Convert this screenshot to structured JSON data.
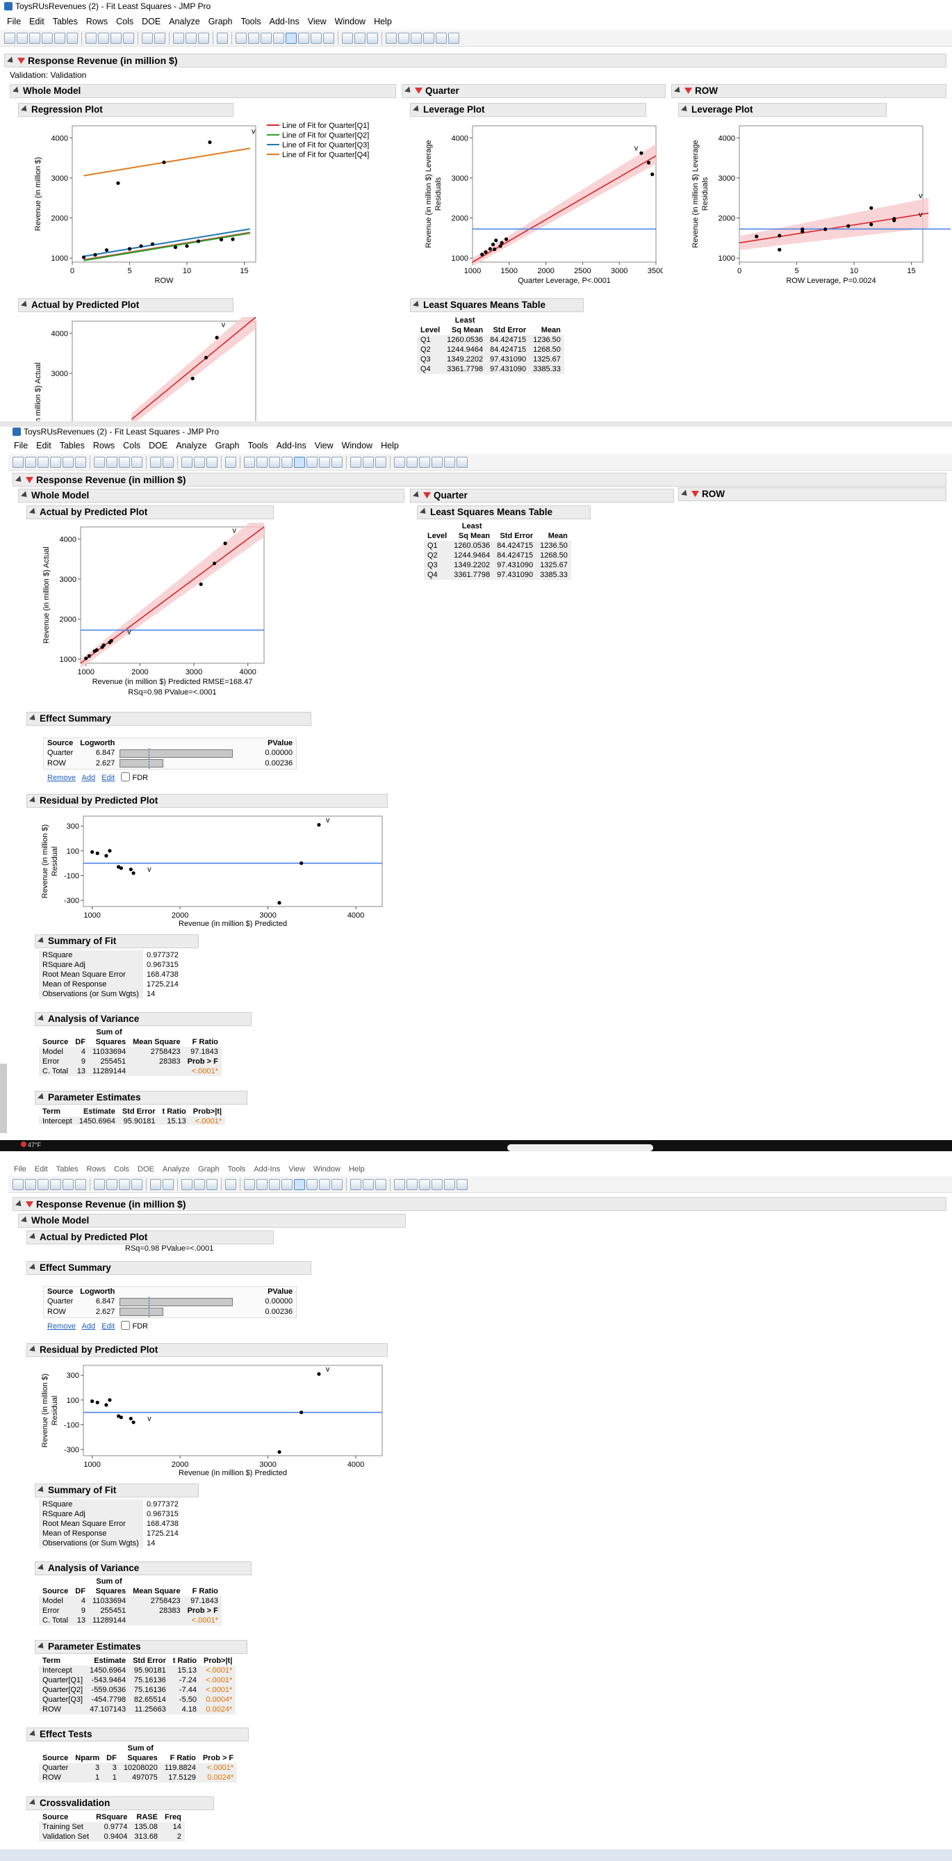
{
  "window": {
    "title": "ToysRUsRevenues (2) - Fit Least Squares - JMP Pro"
  },
  "menu": [
    "File",
    "Edit",
    "Tables",
    "Rows",
    "Cols",
    "DOE",
    "Analyze",
    "Graph",
    "Tools",
    "Add-Ins",
    "View",
    "Window",
    "Help"
  ],
  "report": {
    "title": "Response Revenue (in million $)",
    "validation": "Validation: Validation",
    "whole_model": "Whole Model",
    "quarter": "Quarter",
    "row": "ROW",
    "regression_plot": "Regression Plot",
    "leverage_plot": "Leverage Plot",
    "actual_by_predicted": "Actual by Predicted Plot",
    "lsm_table": "Least Squares Means Table",
    "effect_summary": "Effect Summary",
    "residual_plot": "Residual by Predicted Plot",
    "summary_of_fit": "Summary of Fit",
    "anova": "Analysis of Variance",
    "param_estimates": "Parameter Estimates",
    "effect_tests": "Effect Tests",
    "crossvalidation": "Crossvalidation"
  },
  "regression": {
    "ylabel": "Revenue (in million $)",
    "xlabel": "ROW",
    "legend": [
      "Line of Fit for Quarter[Q1]",
      "Line of Fit for Quarter[Q2]",
      "Line of Fit for Quarter[Q3]",
      "Line of Fit for Quarter[Q4]"
    ],
    "colors": [
      "#d62728",
      "#2ca02c",
      "#1f77b4",
      "#e07b1a"
    ]
  },
  "quarter_leverage": {
    "ylabel1": "Revenue (in million $) Leverage",
    "ylabel2": "Residuals",
    "xlabel": "Quarter Leverage, P<.0001"
  },
  "row_leverage": {
    "ylabel1": "Revenue (in million $) Leverage",
    "ylabel2": "Residuals",
    "xlabel": "ROW Leverage, P=0.0024"
  },
  "actual_pred": {
    "ylabel": "Revenue (in million $) Actual",
    "ylabel_cut": "h (in million $) Actual",
    "xlabel": "Revenue (in million $) Predicted RMSE=168.47",
    "stats": "RSq=0.98 PValue=<.0001"
  },
  "residual": {
    "ylabel1": "Revenue (in million $)",
    "ylabel2": "Residual",
    "xlabel": "Revenue (in million $) Predicted"
  },
  "lsm": {
    "headers": [
      "Level",
      "Least Sq Mean",
      "Std Error",
      "Mean"
    ],
    "hdr_least": "Least",
    "hdr_sqmean": "Sq Mean",
    "rows": [
      [
        "Q1",
        "1260.0536",
        "84.424715",
        "1236.50"
      ],
      [
        "Q2",
        "1244.9464",
        "84.424715",
        "1268.50"
      ],
      [
        "Q3",
        "1349.2202",
        "97.431090",
        "1325.67"
      ],
      [
        "Q4",
        "3361.7798",
        "97.431090",
        "3385.33"
      ]
    ]
  },
  "effect_summary": {
    "headers": [
      "Source",
      "Logworth",
      "PValue"
    ],
    "rows": [
      [
        "Quarter",
        "6.847",
        "0.00000"
      ],
      [
        "ROW",
        "2.627",
        "0.00236"
      ]
    ],
    "logworth_values": [
      6.847,
      2.627
    ],
    "links": [
      "Remove",
      "Add",
      "Edit"
    ],
    "fdr": "FDR"
  },
  "summary_of_fit": {
    "rows": [
      [
        "RSquare",
        "0.977372"
      ],
      [
        "RSquare Adj",
        "0.967315"
      ],
      [
        "Root Mean Square Error",
        "168.4738"
      ],
      [
        "Mean of Response",
        "1725.214"
      ],
      [
        "Observations (or Sum Wgts)",
        "14"
      ]
    ]
  },
  "anova": {
    "hdr_sum": "Sum of",
    "headers": [
      "Source",
      "DF",
      "Squares",
      "Mean Square",
      "F Ratio"
    ],
    "rows": [
      [
        "Model",
        "4",
        "11033694",
        "2758423",
        "97.1843"
      ],
      [
        "Error",
        "9",
        "255451",
        "28383",
        "Prob > F"
      ],
      [
        "C. Total",
        "13",
        "11289144",
        "",
        "<.0001*"
      ]
    ]
  },
  "params": {
    "headers": [
      "Term",
      "Estimate",
      "Std Error",
      "t Ratio",
      "Prob>|t|"
    ],
    "rows": [
      [
        "Intercept",
        "1450.6964",
        "95.90181",
        "15.13",
        "<.0001*"
      ],
      [
        "Quarter[Q1]",
        "-543.9464",
        "75.16136",
        "-7.24",
        "<.0001*"
      ],
      [
        "Quarter[Q2]",
        "-559.0536",
        "75.16136",
        "-7.44",
        "<.0001*"
      ],
      [
        "Quarter[Q3]",
        "-454.7798",
        "82.65514",
        "-5.50",
        "0.0004*"
      ],
      [
        "ROW",
        "47.107143",
        "11.25663",
        "4.18",
        "0.0024*"
      ]
    ],
    "cut_row": [
      "Intercept",
      "1450.6964",
      "95.90181",
      "15.13",
      "<.0001*"
    ]
  },
  "effect_tests": {
    "hdr_sum": "Sum of",
    "headers": [
      "Source",
      "Nparm",
      "DF",
      "Squares",
      "F Ratio",
      "Prob > F"
    ],
    "rows": [
      [
        "Quarter",
        "3",
        "3",
        "10208020",
        "119.8824",
        "<.0001*"
      ],
      [
        "ROW",
        "1",
        "1",
        "497075",
        "17.5129",
        "0.0024*"
      ]
    ]
  },
  "crossval": {
    "headers": [
      "Source",
      "RSquare",
      "RASE",
      "Freq"
    ],
    "rows": [
      [
        "Training Set",
        "0.9774",
        "135.08",
        "14"
      ],
      [
        "Validation Set",
        "0.9404",
        "313.68",
        "2"
      ]
    ]
  },
  "taskbar": {
    "temp": "47°F"
  },
  "chart_data": [
    {
      "type": "scatter",
      "title": "Regression Plot",
      "xlabel": "ROW",
      "ylabel": "Revenue (in million $)",
      "xlim": [
        0,
        16
      ],
      "ylim": [
        900,
        4300
      ],
      "series": [
        {
          "name": "points",
          "x": [
            1,
            2,
            3,
            4,
            5,
            6,
            7,
            8,
            9,
            10,
            11,
            12,
            13,
            14
          ],
          "y": [
            1020,
            1080,
            1200,
            2870,
            1230,
            1300,
            1350,
            3390,
            1270,
            1300,
            1420,
            3890,
            1460,
            1470
          ]
        },
        {
          "name": "Line of Fit for Quarter[Q1]",
          "x": [
            1,
            15.5
          ],
          "y": [
            954,
            1637
          ]
        },
        {
          "name": "Line of Fit for Quarter[Q2]",
          "x": [
            1,
            15.5
          ],
          "y": [
            939,
            1622
          ]
        },
        {
          "name": "Line of Fit for Quarter[Q3]",
          "x": [
            1,
            15.5
          ],
          "y": [
            1043,
            1726
          ]
        },
        {
          "name": "Line of Fit for Quarter[Q4]",
          "x": [
            1,
            15.5
          ],
          "y": [
            3056,
            3739
          ]
        }
      ]
    },
    {
      "type": "scatter",
      "title": "Quarter Leverage Plot",
      "xlabel": "Quarter Leverage, P<.0001",
      "xlim": [
        1000,
        3500
      ],
      "ylim": [
        900,
        4300
      ]
    },
    {
      "type": "scatter",
      "title": "ROW Leverage Plot",
      "xlabel": "ROW Leverage, P=0.0024",
      "xlim": [
        0,
        16
      ],
      "ylim": [
        900,
        4300
      ]
    },
    {
      "type": "scatter",
      "title": "Actual by Predicted Plot",
      "xlabel": "Revenue (in million $) Predicted RMSE=168.47",
      "xlim": [
        900,
        4300
      ],
      "ylim": [
        900,
        4300
      ]
    },
    {
      "type": "scatter",
      "title": "Residual by Predicted Plot",
      "xlabel": "Revenue (in million $) Predicted",
      "ylabel": "Residual",
      "xlim": [
        900,
        4300
      ],
      "ylim": [
        -350,
        380
      ],
      "series": [
        {
          "name": "residuals",
          "x": [
            1000,
            1060,
            1160,
            1200,
            1300,
            1330,
            1440,
            1470,
            3130,
            3380,
            3580
          ],
          "y": [
            90,
            80,
            60,
            100,
            -30,
            -40,
            -50,
            -80,
            -320,
            0,
            310
          ]
        }
      ]
    }
  ]
}
